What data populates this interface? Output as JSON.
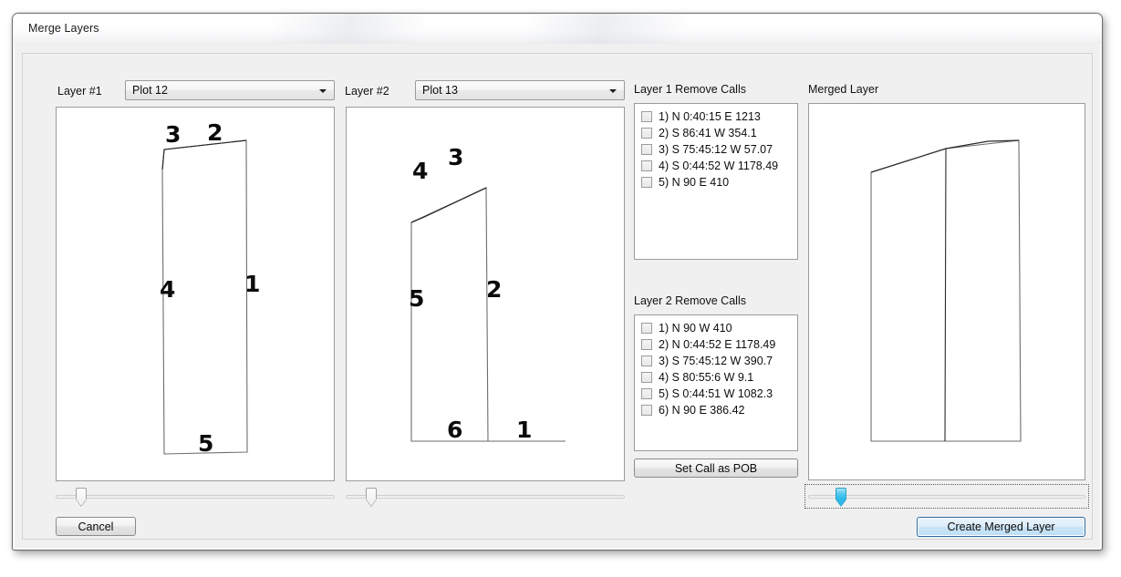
{
  "window": {
    "title": "Merge Layers"
  },
  "layer1": {
    "label": "Layer #1",
    "selected": "Plot 12",
    "shape_labels": [
      "1",
      "2",
      "3",
      "4",
      "5"
    ]
  },
  "layer2": {
    "label": "Layer #2",
    "selected": "Plot 13",
    "shape_labels": [
      "1",
      "2",
      "3",
      "4",
      "5",
      "6"
    ]
  },
  "merged": {
    "label": "Merged Layer"
  },
  "layer1_remove_calls": {
    "title": "Layer 1 Remove Calls",
    "items": [
      {
        "text": "1) N 0:40:15 E 1213",
        "checked": false
      },
      {
        "text": "2) S 86:41 W 354.1",
        "checked": false
      },
      {
        "text": "3) S 75:45:12 W 57.07",
        "checked": false
      },
      {
        "text": "4) S 0:44:52 W 1178.49",
        "checked": false
      },
      {
        "text": "5) N 90 E 410",
        "checked": false
      }
    ]
  },
  "layer2_remove_calls": {
    "title": "Layer 2 Remove Calls",
    "items": [
      {
        "text": "1) N 90 W 410",
        "checked": false
      },
      {
        "text": "2) N 0:44:52 E 1178.49",
        "checked": false
      },
      {
        "text": "3) S 75:45:12 W 390.7",
        "checked": false
      },
      {
        "text": "4) S 80:55:6 W 9.1",
        "checked": false
      },
      {
        "text": "5) S 0:44:51 W 1082.3",
        "checked": false
      },
      {
        "text": "6) N 90 E 386.42",
        "checked": false
      }
    ]
  },
  "buttons": {
    "set_call_as_pob": "Set Call as POB",
    "cancel": "Cancel",
    "create_merged_layer": "Create Merged Layer"
  },
  "sliders": {
    "layer1_zoom_percent": 9,
    "layer2_zoom_percent": 9,
    "merged_zoom_percent": 11
  },
  "colors": {
    "window_bg": "#f0f0f0",
    "canvas_bg": "#ffffff",
    "accent_focus": "#2eb9e8",
    "default_button_border": "#2c6aa0",
    "outline": "#1a1a1a"
  }
}
